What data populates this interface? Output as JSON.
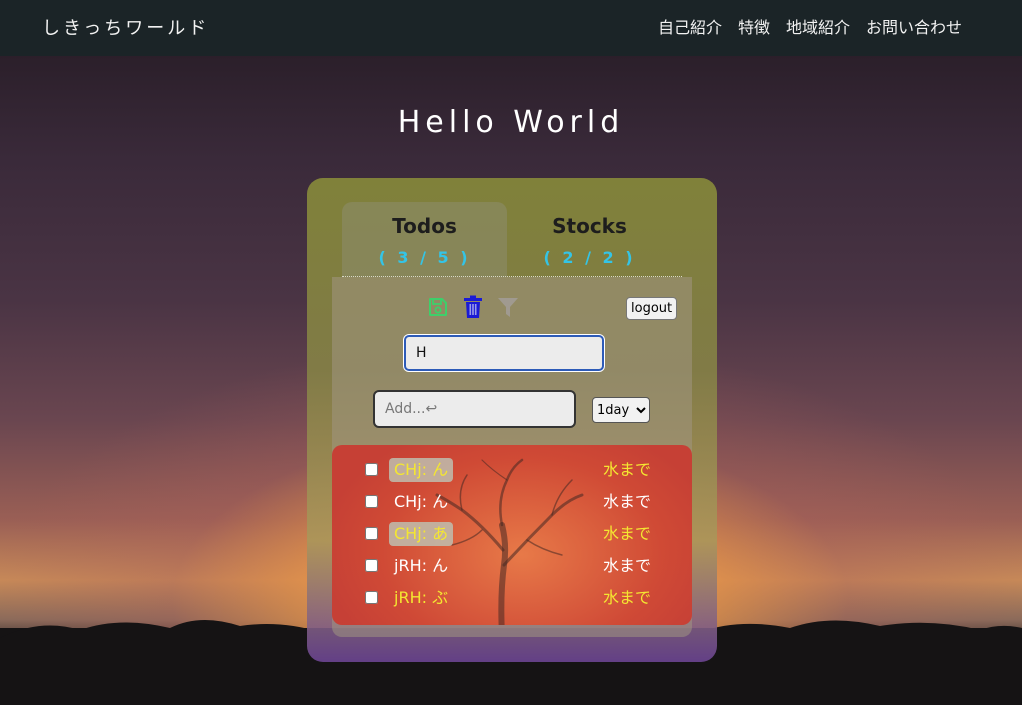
{
  "nav": {
    "brand": "しきっちワールド",
    "links": [
      "自己紹介",
      "特徴",
      "地域紹介",
      "お問い合わせ"
    ]
  },
  "hero": {
    "title": "Hello World"
  },
  "tabs": [
    {
      "label": "Todos",
      "count": "( 3 / 5 )",
      "active": true
    },
    {
      "label": "Stocks",
      "count": "( 2 / 2 )",
      "active": false
    }
  ],
  "toolbar": {
    "icons": [
      "save-icon",
      "trash-icon",
      "filter-icon"
    ],
    "logout_label": "logout"
  },
  "search": {
    "value": "H"
  },
  "add": {
    "placeholder": "Add...↩"
  },
  "deadline": {
    "selected": "1day",
    "options": [
      "1day"
    ]
  },
  "todos": [
    {
      "title": "CHj: ん",
      "due": "水まで",
      "checked": false,
      "highlighted": true,
      "color": "yellow"
    },
    {
      "title": "CHj: ん",
      "due": "水まで",
      "checked": false,
      "highlighted": false,
      "color": "white"
    },
    {
      "title": "CHj: あ",
      "due": "水まで",
      "checked": false,
      "highlighted": true,
      "color": "yellow"
    },
    {
      "title": "jRH: ん",
      "due": "水まで",
      "checked": false,
      "highlighted": false,
      "color": "white"
    },
    {
      "title": "jRH: ぶ",
      "due": "水まで",
      "checked": false,
      "highlighted": false,
      "color": "yellow"
    }
  ],
  "colors": {
    "nav_bg": "#1b2427",
    "count": "#34c4e6",
    "accent_yellow": "#f4e631",
    "save_icon": "#3ecf6a",
    "trash_icon": "#1a1ad6",
    "filter_icon": "#a09a90"
  }
}
